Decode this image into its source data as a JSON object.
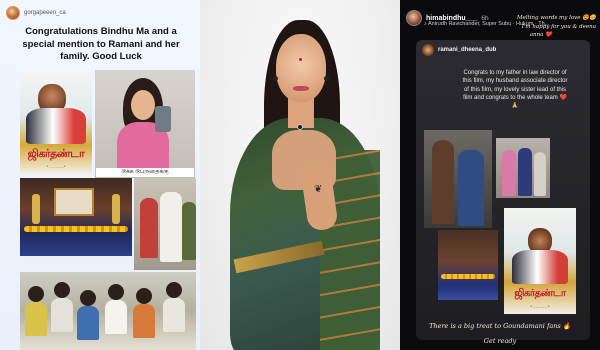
{
  "panel1": {
    "username": "gorgapeeen_ca",
    "caption": "Congratulations Bindhu Ma and a special mention to Ramani and her family.  Good Luck",
    "poster_title": "ஜிகர்தண்டா",
    "poster_small": "* - - - - - - *",
    "selfie_caption": "டூக்க டூப்ருதைக்கு"
  },
  "panel2": {},
  "panel3": {
    "username": "himabindhu___",
    "time": "6h",
    "music": "♪ Anirudh Ravichander, Super Subu · Hukum · Th...",
    "replies": [
      "Melting words my love 😍🥺",
      "I'm happy for you & deena",
      "anna ❤️"
    ],
    "card": {
      "username": "ramani_dheena_dub",
      "text": "Congrats to my father in law director of this film, my husband associate director of this film, my lovely sister lead of this film and congrats to the whole team ❤️🙏",
      "poster_title": "ஜிகர்தண்டா",
      "poster_small": "* - - - - - - *"
    },
    "footer_line1": "There is a big treat to Goundamani fans 🔥",
    "footer_line2": "Get ready"
  },
  "colors": {
    "story_light_bg": "#eef4fd",
    "story_dark_bg": "#0b0b0d",
    "poster_title_red": "#c0202a"
  }
}
